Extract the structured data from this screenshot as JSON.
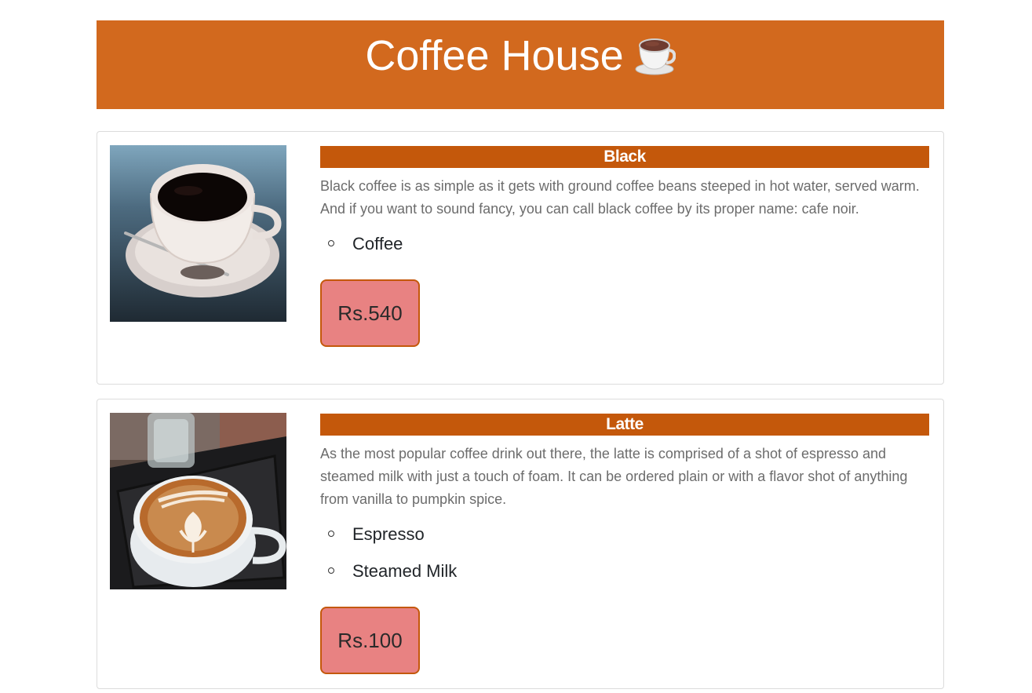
{
  "header": {
    "title": "Coffee House",
    "icon": "coffee-cup-icon"
  },
  "colors": {
    "header_bg": "#d2691e",
    "title_bar_bg": "#c4580b",
    "price_bg": "#e88282",
    "price_border": "#c4580b"
  },
  "items": [
    {
      "name": "Black",
      "image": "black-coffee-photo",
      "description": "Black coffee is as simple as it gets with ground coffee beans steeped in hot water, served warm. And if you want to sound fancy, you can call black coffee by its proper name: cafe noir.",
      "ingredients": [
        "Coffee"
      ],
      "price": "Rs.540"
    },
    {
      "name": "Latte",
      "image": "latte-photo",
      "description": "As the most popular coffee drink out there, the latte is comprised of a shot of espresso and steamed milk with just a touch of foam. It can be ordered plain or with a flavor shot of anything from vanilla to pumpkin spice.",
      "ingredients": [
        "Espresso",
        "Steamed Milk"
      ],
      "price": "Rs.100"
    }
  ]
}
